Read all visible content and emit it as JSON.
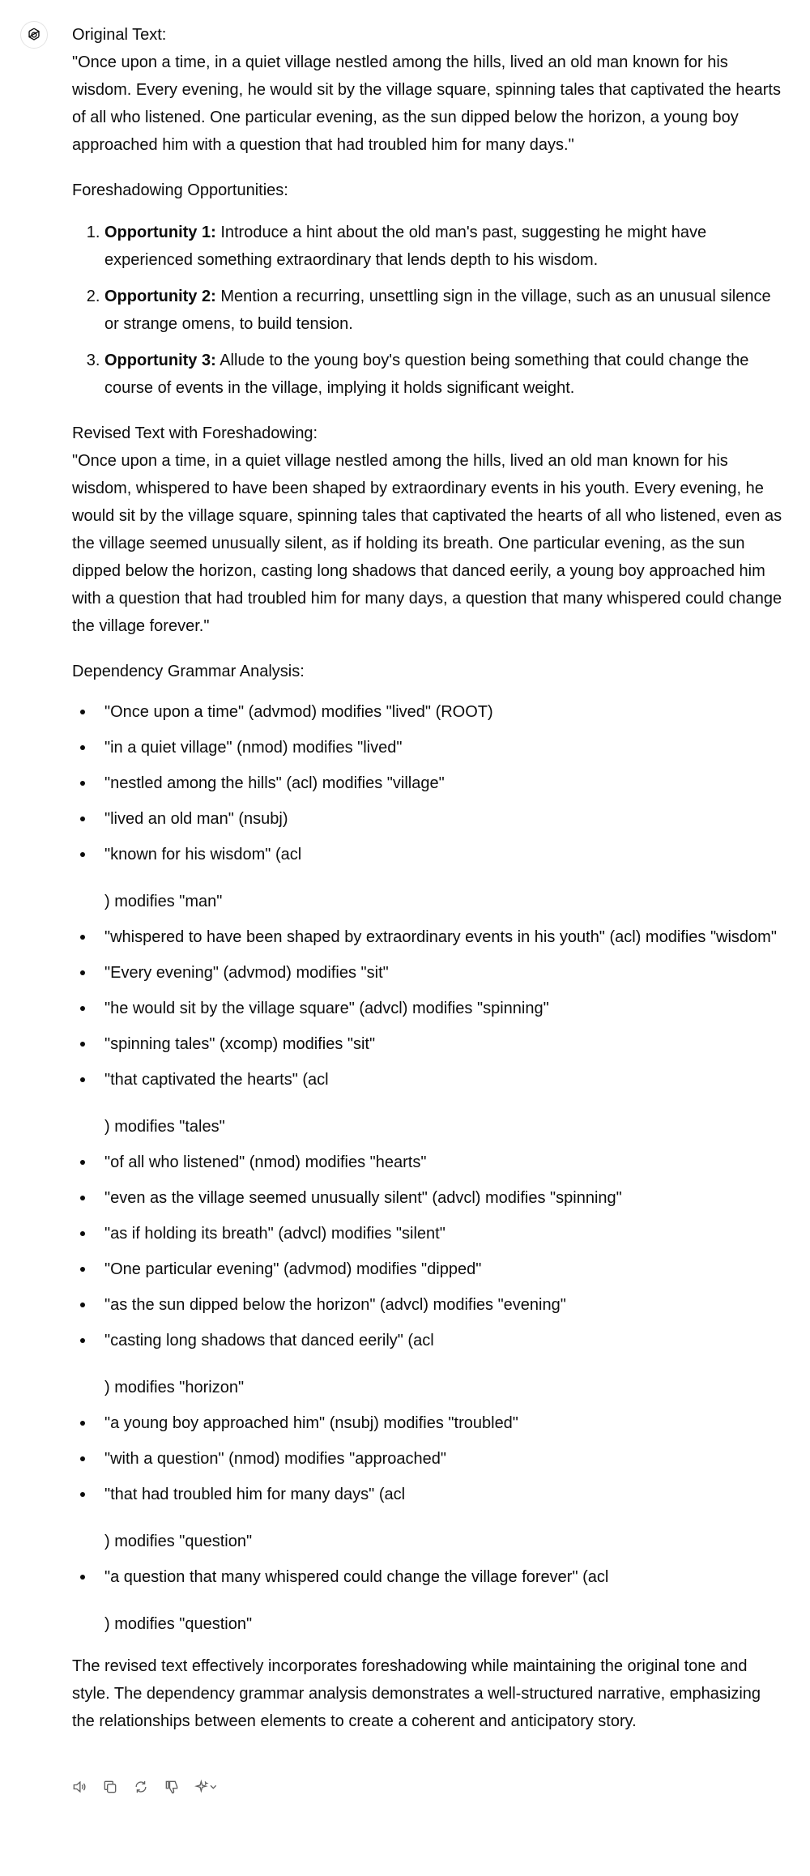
{
  "assistant": {
    "avatar_icon": "openai-logo-icon"
  },
  "original": {
    "heading": "Original Text:",
    "text": "\"Once upon a time, in a quiet village nestled among the hills, lived an old man known for his wisdom. Every evening, he would sit by the village square, spinning tales that captivated the hearts of all who listened. One particular evening, as the sun dipped below the horizon, a young boy approached him with a question that had troubled him for many days.\""
  },
  "foreshadowing": {
    "heading": "Foreshadowing Opportunities:",
    "items": [
      {
        "label": "Opportunity 1:",
        "text": " Introduce a hint about the old man's past, suggesting he might have experienced something extraordinary that lends depth to his wisdom."
      },
      {
        "label": "Opportunity 2:",
        "text": " Mention a recurring, unsettling sign in the village, such as an unusual silence or strange omens, to build tension."
      },
      {
        "label": "Opportunity 3:",
        "text": " Allude to the young boy's question being something that could change the course of events in the village, implying it holds significant weight."
      }
    ]
  },
  "revised": {
    "heading": "Revised Text with Foreshadowing:",
    "text": "\"Once upon a time, in a quiet village nestled among the hills, lived an old man known for his wisdom, whispered to have been shaped by extraordinary events in his youth. Every evening, he would sit by the village square, spinning tales that captivated the hearts of all who listened, even as the village seemed unusually silent, as if holding its breath. One particular evening, as the sun dipped below the horizon, casting long shadows that danced eerily, a young boy approached him with a question that had troubled him for many days, a question that many whispered could change the village forever.\""
  },
  "dependency": {
    "heading": "Dependency Grammar Analysis:",
    "items": [
      {
        "text": "\"Once upon a time\" (advmod) modifies \"lived\" (ROOT)"
      },
      {
        "text": "\"in a quiet village\" (nmod) modifies \"lived\""
      },
      {
        "text": "\"nestled among the hills\" (acl) modifies \"village\""
      },
      {
        "text": "\"lived an old man\" (nsubj)"
      },
      {
        "text": "\"known for his wisdom\" (acl",
        "cont": ") modifies \"man\""
      },
      {
        "text": "\"whispered to have been shaped by extraordinary events in his youth\" (acl) modifies \"wisdom\""
      },
      {
        "text": "\"Every evening\" (advmod) modifies \"sit\""
      },
      {
        "text": "\"he would sit by the village square\" (advcl) modifies \"spinning\""
      },
      {
        "text": "\"spinning tales\" (xcomp) modifies \"sit\""
      },
      {
        "text": "\"that captivated the hearts\" (acl",
        "cont": ") modifies \"tales\""
      },
      {
        "text": "\"of all who listened\" (nmod) modifies \"hearts\""
      },
      {
        "text": "\"even as the village seemed unusually silent\" (advcl) modifies \"spinning\""
      },
      {
        "text": "\"as if holding its breath\" (advcl) modifies \"silent\""
      },
      {
        "text": "\"One particular evening\" (advmod) modifies \"dipped\""
      },
      {
        "text": "\"as the sun dipped below the horizon\" (advcl) modifies \"evening\""
      },
      {
        "text": "\"casting long shadows that danced eerily\" (acl",
        "cont": ") modifies \"horizon\""
      },
      {
        "text": "\"a young boy approached him\" (nsubj) modifies \"troubled\""
      },
      {
        "text": "\"with a question\" (nmod) modifies \"approached\""
      },
      {
        "text": "\"that had troubled him for many days\" (acl",
        "cont": ") modifies \"question\""
      },
      {
        "text": "\"a question that many whispered could change the village forever\" (acl",
        "cont": ") modifies \"question\""
      }
    ]
  },
  "conclusion": "The revised text effectively incorporates foreshadowing while maintaining the original tone and style. The dependency grammar analysis demonstrates a well-structured narrative, emphasizing the relationships between elements to create a coherent and anticipatory story.",
  "toolbar": {
    "icons": [
      "read-aloud-icon",
      "copy-icon",
      "regenerate-icon",
      "thumbs-down-icon",
      "model-switch-icon"
    ]
  }
}
